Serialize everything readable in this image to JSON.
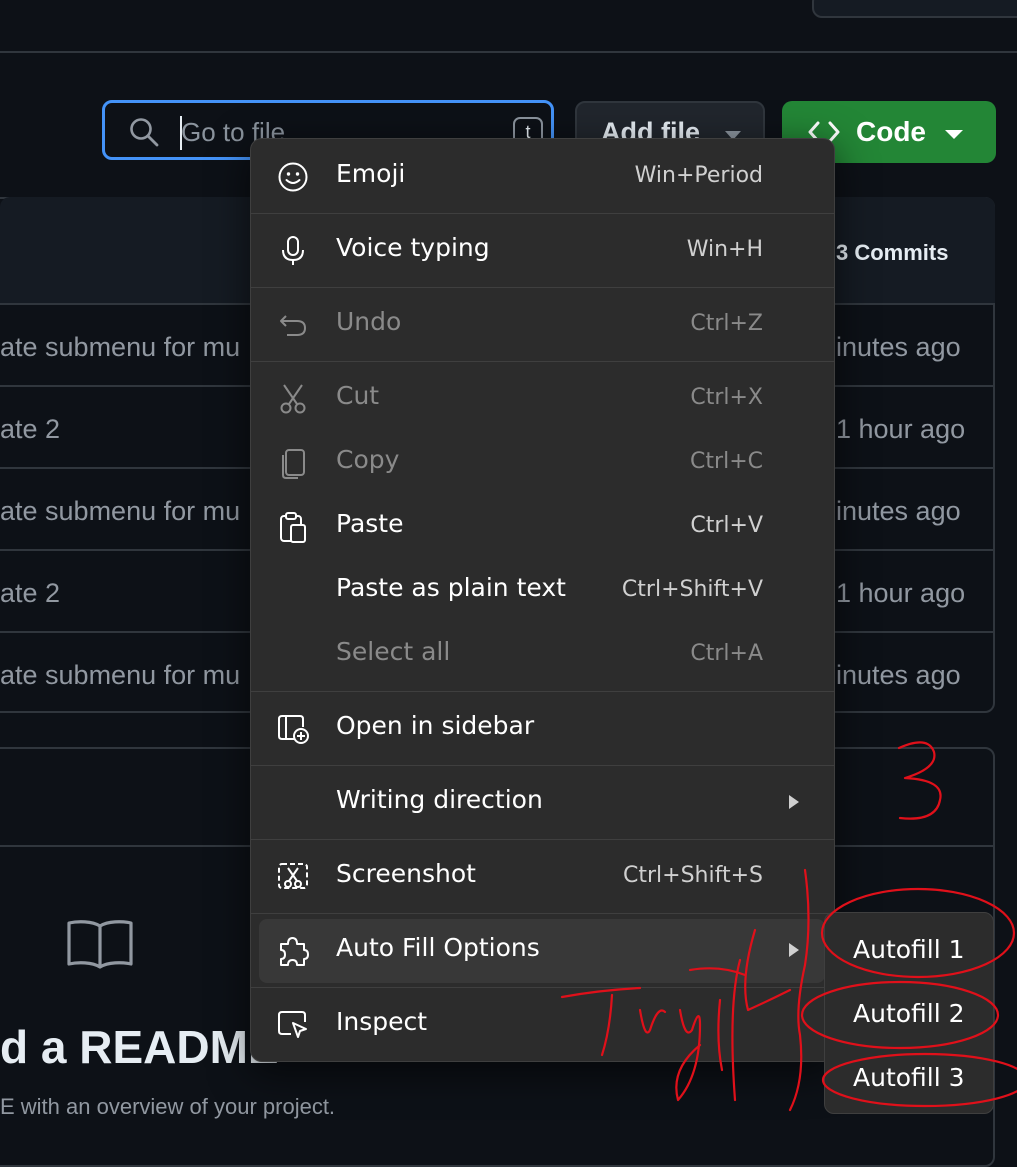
{
  "search": {
    "placeholder": "Go to file",
    "shortcut": "t"
  },
  "toolbar": {
    "add_file_label": "Add file",
    "code_label": "Code"
  },
  "file_table": {
    "commits_label": "3 Commits",
    "rows": [
      {
        "message": "ate submenu for mu",
        "time": "inutes ago"
      },
      {
        "message": "ate 2",
        "time": "1 hour ago"
      },
      {
        "message": "ate submenu for mu",
        "time": "inutes ago"
      },
      {
        "message": "ate 2",
        "time": "1 hour ago"
      },
      {
        "message": "ate submenu for mu",
        "time": "inutes ago"
      }
    ]
  },
  "readme": {
    "title": "d a README",
    "subtitle": "E with an overview of your project."
  },
  "context_menu": {
    "items": [
      {
        "label": "Emoji",
        "shortcut": "Win+Period",
        "icon": "emoji-icon",
        "disabled": false
      },
      {
        "label": "Voice typing",
        "shortcut": "Win+H",
        "icon": "microphone-icon",
        "disabled": false
      },
      {
        "label": "Undo",
        "shortcut": "Ctrl+Z",
        "icon": "undo-icon",
        "disabled": true
      },
      {
        "label": "Cut",
        "shortcut": "Ctrl+X",
        "icon": "scissors-icon",
        "disabled": true
      },
      {
        "label": "Copy",
        "shortcut": "Ctrl+C",
        "icon": "copy-icon",
        "disabled": true
      },
      {
        "label": "Paste",
        "shortcut": "Ctrl+V",
        "icon": "clipboard-icon",
        "disabled": false
      },
      {
        "label": "Paste as plain text",
        "shortcut": "Ctrl+Shift+V",
        "icon": "",
        "disabled": false
      },
      {
        "label": "Select all",
        "shortcut": "Ctrl+A",
        "icon": "",
        "disabled": true
      },
      {
        "label": "Open in sidebar",
        "shortcut": "",
        "icon": "sidebar-add-icon",
        "disabled": false
      },
      {
        "label": "Writing direction",
        "shortcut": "",
        "icon": "",
        "disabled": false
      },
      {
        "label": "Screenshot",
        "shortcut": "Ctrl+Shift+S",
        "icon": "screenshot-icon",
        "disabled": false
      },
      {
        "label": "Auto Fill Options",
        "shortcut": "",
        "icon": "puzzle-icon",
        "disabled": false,
        "highlighted": true
      },
      {
        "label": "Inspect",
        "shortcut": "",
        "icon": "inspect-icon",
        "disabled": false
      }
    ]
  },
  "submenu": {
    "items": [
      {
        "label": "Autofill 1"
      },
      {
        "label": "Autofill 2"
      },
      {
        "label": "Autofill 3"
      }
    ]
  },
  "annotations": {
    "color": "#e0101a",
    "number": "3",
    "handwriting": "Try it"
  },
  "colors": {
    "accent": "#4493f8",
    "code_button": "#238636",
    "menu_bg": "#2c2c2c"
  }
}
